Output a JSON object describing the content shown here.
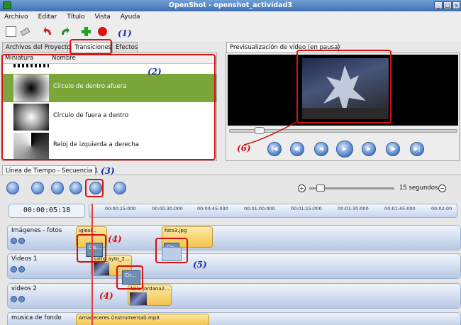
{
  "window": {
    "title": "OpenShot - openshot_actividad3"
  },
  "menu": [
    "Archivo",
    "Editar",
    "Título",
    "Vista",
    "Ayuda"
  ],
  "toolbar": {
    "icons": [
      "new-project",
      "open",
      "undo",
      "redo",
      "add-files",
      "record"
    ]
  },
  "left_tabs": [
    "Archivos del Proyecto",
    "Transiciones",
    "Efectos"
  ],
  "list": {
    "columns": [
      "Miniatura",
      "Nombre"
    ],
    "rows": [
      {
        "name": "Círculo de dentro afuera",
        "selected": true
      },
      {
        "name": "Círculo de fuera a dentro",
        "selected": false
      },
      {
        "name": "Reloj de izquierda a derecha",
        "selected": false
      }
    ]
  },
  "preview": {
    "tab": "Previsualización de vídeo (en pausa)"
  },
  "timeline": {
    "tab": "Línea de Tiempo - Secuencia 1",
    "zoom_label": "15 segundos",
    "timecode": "00:00:05:18",
    "ruler_ticks": [
      "00:00:15:000",
      "00:00:30:000",
      "00:00:45:000",
      "00:01:00:000",
      "00:01:15:000",
      "00:01:30:000",
      "00:01:45:000",
      "00:02:00"
    ],
    "tracks": [
      {
        "name": "Imágenes -  fotos"
      },
      {
        "name": "Videos 1"
      },
      {
        "name": "videos 2"
      },
      {
        "name": "musica de fondo"
      }
    ],
    "clips": {
      "iglesia": "iglesi...",
      "foto3": "foto3.jpg",
      "salto": "salto_ayto_2...",
      "jordana": "falla jordana2...",
      "music": "Amaneceres (instrumental).mp3"
    },
    "transitions": {
      "dis": "Dis...",
      "cir": "Cir...",
      "cir2": "Cir..."
    }
  },
  "annotations": [
    "(1)",
    "(2)",
    "(3)",
    "(4)",
    "(4)",
    "(5)",
    "(6)"
  ],
  "colors": {
    "selection": "#7aa63a",
    "annotation_box": "#d41010",
    "annotation_number": "#1d2fb0",
    "clip": "#f4c44d"
  }
}
